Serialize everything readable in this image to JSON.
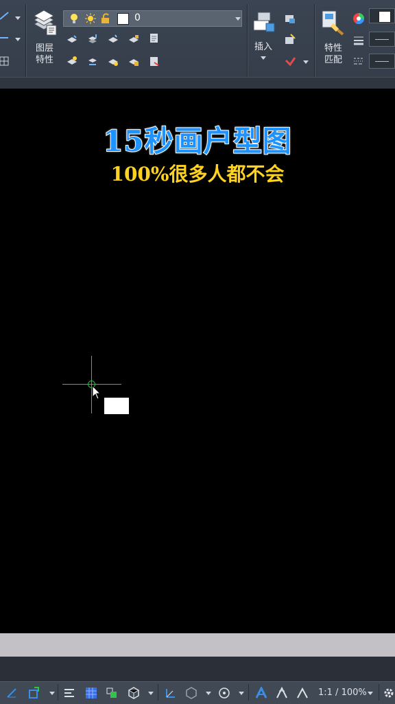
{
  "ribbon": {
    "layer_properties_label_line1": "图层",
    "layer_properties_label_line2": "特性",
    "layer_combo_value": "0",
    "insert_label": "插入",
    "match_properties_label_line1": "特性",
    "match_properties_label_line2": "匹配"
  },
  "overlay": {
    "title": "15秒画户型图",
    "subtitle": "100%很多人都不会"
  },
  "status": {
    "annotation_scale": "1:1 / 100%"
  },
  "colors": {
    "ribbon_bg": "#3b4452",
    "canvas_bg": "#000000",
    "title_blue": "#1e93ff",
    "subtitle_yellow": "#ffd21f",
    "osnap_green": "#1fbf3a",
    "command_line_bg": "#c3c0c6"
  },
  "icons": [
    "draw-icon",
    "layer-properties-icon",
    "lightbulb-icon",
    "sun-icon",
    "lock-icon",
    "insert-block-icon",
    "match-properties-icon",
    "color-wheel-icon",
    "lineweight-icon",
    "linetype-icon",
    "settings-icon"
  ]
}
